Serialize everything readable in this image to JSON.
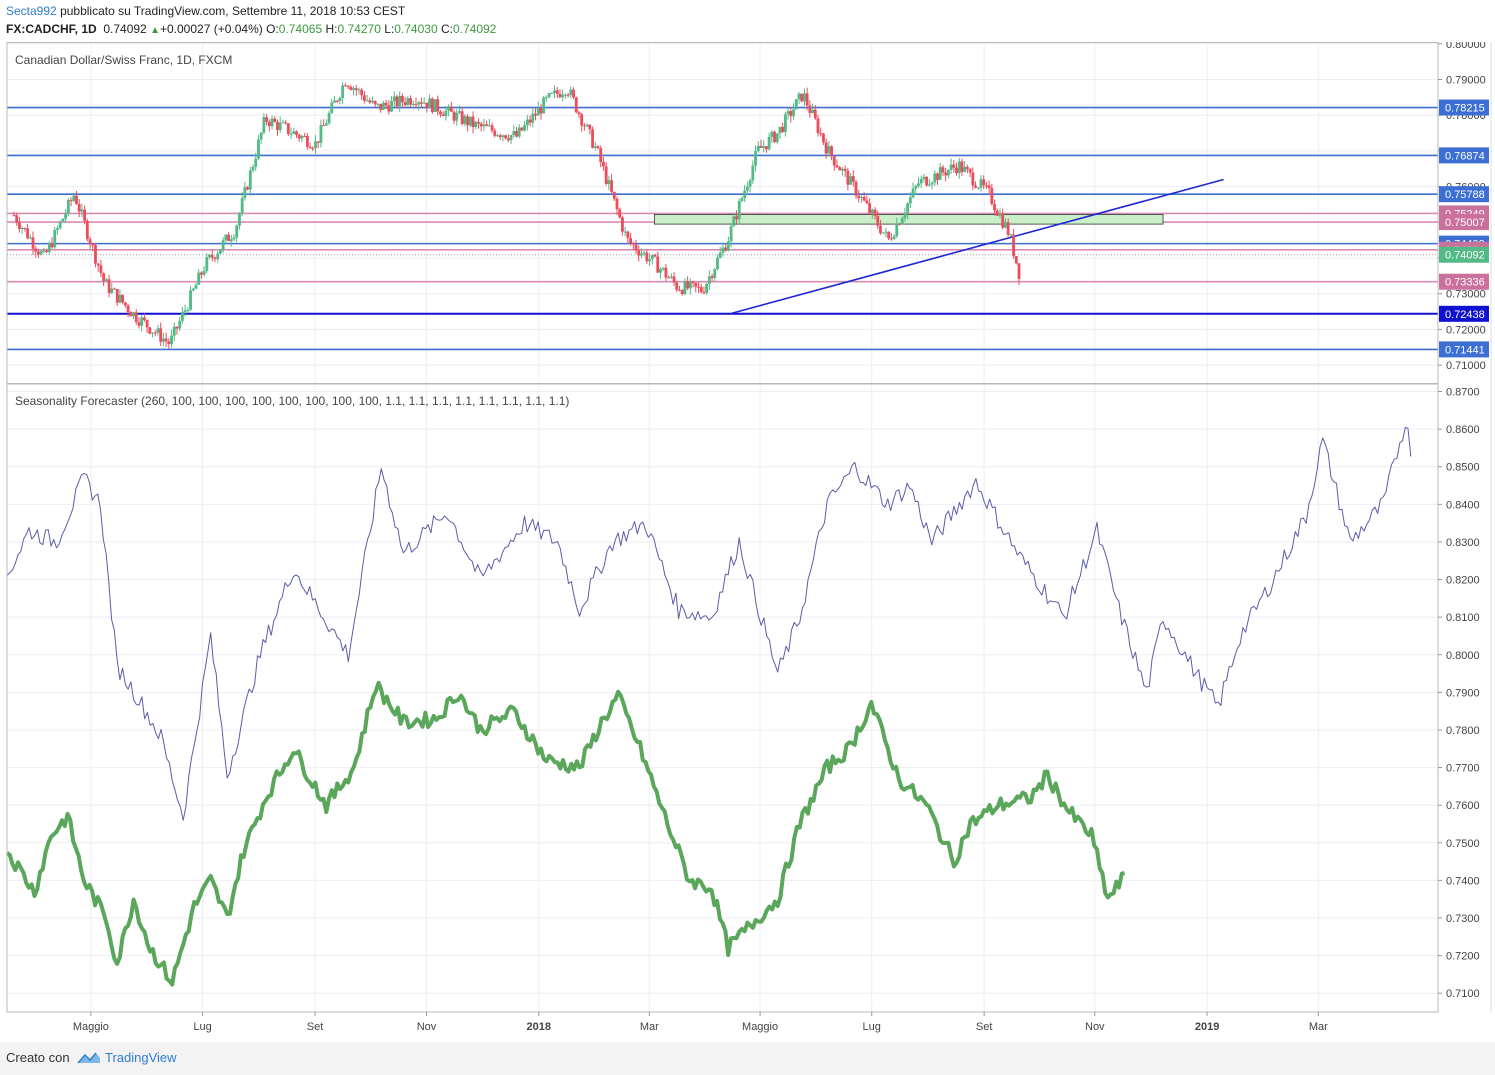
{
  "header": {
    "user": "Secta992",
    "published": "pubblicato su TradingView.com, Settembre 11, 2018 10:53 CEST",
    "symbol": "FX:CADCHF, 1D",
    "last": "0.74092",
    "change": "+0.00027 (+0.04%)",
    "o_label": "O:",
    "o_value": "0.74065",
    "h_label": "H:",
    "h_value": "0.74270",
    "l_label": "L:",
    "l_value": "0.74030",
    "c_label": "C:",
    "c_value": "0.74092"
  },
  "footer": {
    "created": "Creato con",
    "brand": "TradingView"
  },
  "colors": {
    "up": "#53b987",
    "down": "#eb4d5c",
    "hline_blue": "#3b6fd4",
    "hline_pink": "#d98cb3",
    "trend": "#1f26d6",
    "zone_fill": "#c9efc9",
    "forecast": "#5c5ca8",
    "series2": "#5aa65a"
  },
  "chart_data": [
    {
      "type": "candlestick",
      "title": "Canadian Dollar/Swiss Franc, 1D, FXCM",
      "ylim": [
        0.705,
        0.8005
      ],
      "y_ticks": [
        "0.80000",
        "0.79000",
        "0.78000",
        "0.77000",
        "0.76000",
        "0.75000",
        "0.74000",
        "0.73000",
        "0.72000",
        "0.71000"
      ],
      "horizontal_levels": [
        {
          "value": 0.78215,
          "label": "0.78215",
          "color": "blue"
        },
        {
          "value": 0.76874,
          "label": "0.76874",
          "color": "blue"
        },
        {
          "value": 0.75788,
          "label": "0.75788",
          "color": "blue"
        },
        {
          "value": 0.75249,
          "label": "0.75249",
          "color": "pink"
        },
        {
          "value": 0.75007,
          "label": "0.75007",
          "color": "pink"
        },
        {
          "value": 0.74403,
          "label": "0.74403",
          "color": "blue"
        },
        {
          "value": 0.74231,
          "label": "0.74231",
          "color": "pink"
        },
        {
          "value": 0.73336,
          "label": "0.73336",
          "color": "pink"
        },
        {
          "value": 0.72438,
          "label": "0.72438",
          "color": "navy"
        },
        {
          "value": 0.71441,
          "label": "0.71441",
          "color": "blue"
        }
      ],
      "last_price": {
        "value": 0.74092,
        "label": "0.74092"
      },
      "points": [
        [
          0.0,
          0.752
        ],
        [
          0.03,
          0.74
        ],
        [
          0.06,
          0.758
        ],
        [
          0.09,
          0.733
        ],
        [
          0.12,
          0.724
        ],
        [
          0.155,
          0.716
        ],
        [
          0.19,
          0.738
        ],
        [
          0.22,
          0.748
        ],
        [
          0.25,
          0.779
        ],
        [
          0.3,
          0.772
        ],
        [
          0.33,
          0.79
        ],
        [
          0.36,
          0.782
        ],
        [
          0.4,
          0.785
        ],
        [
          0.46,
          0.777
        ],
        [
          0.5,
          0.774
        ],
        [
          0.53,
          0.784
        ],
        [
          0.55,
          0.788
        ],
        [
          0.58,
          0.77
        ],
        [
          0.61,
          0.745
        ],
        [
          0.64,
          0.738
        ],
        [
          0.66,
          0.732
        ],
        [
          0.685,
          0.731
        ],
        [
          0.71,
          0.745
        ],
        [
          0.74,
          0.77
        ],
        [
          0.76,
          0.775
        ],
        [
          0.785,
          0.786
        ],
        [
          0.81,
          0.77
        ],
        [
          0.84,
          0.758
        ],
        [
          0.87,
          0.745
        ],
        [
          0.9,
          0.761
        ],
        [
          0.94,
          0.766
        ],
        [
          0.97,
          0.758
        ],
        [
          0.99,
          0.747
        ],
        [
          1.0,
          0.736
        ]
      ],
      "overlays": {
        "trendline": {
          "from": [
            0.658,
            0.7245
          ],
          "to": [
            1.105,
            0.762
          ]
        },
        "zone": {
          "from": 0.588,
          "to": 1.05,
          "top": 0.7522,
          "bottom": 0.7495
        }
      },
      "x_tick_labels": [
        "Maggio",
        "Lug",
        "Set",
        "Nov",
        "2018",
        "Mar",
        "Maggio",
        "Lug",
        "Set",
        "Nov",
        "2019",
        "Mar"
      ]
    },
    {
      "type": "line",
      "title": "Seasonality Forecaster (260, 100, 100, 100, 100, 100, 100, 100, 100, 1.1, 1.1, 1.1, 1.1, 1.1, 1.1, 1.1, 1.1)",
      "ylim": [
        0.705,
        0.872
      ],
      "y_ticks": [
        "0.8700",
        "0.8600",
        "0.8500",
        "0.8400",
        "0.8300",
        "0.8200",
        "0.8100",
        "0.8000",
        "0.7900",
        "0.7800",
        "0.7700",
        "0.7600",
        "0.7500",
        "0.7400",
        "0.7300",
        "0.7200",
        "0.7100"
      ],
      "series": [
        {
          "points": [
            [
              0.0,
              0.821
            ],
            [
              0.02,
              0.833
            ],
            [
              0.045,
              0.83
            ],
            [
              0.07,
              0.847
            ],
            [
              0.085,
              0.84
            ],
            [
              0.1,
              0.797
            ],
            [
              0.12,
              0.788
            ],
            [
              0.14,
              0.778
            ],
            [
              0.16,
              0.757
            ],
            [
              0.185,
              0.805
            ],
            [
              0.2,
              0.768
            ],
            [
              0.23,
              0.8
            ],
            [
              0.26,
              0.823
            ],
            [
              0.31,
              0.8
            ],
            [
              0.34,
              0.85
            ],
            [
              0.36,
              0.827
            ],
            [
              0.4,
              0.838
            ],
            [
              0.43,
              0.82
            ],
            [
              0.47,
              0.835
            ],
            [
              0.5,
              0.83
            ],
            [
              0.52,
              0.812
            ],
            [
              0.55,
              0.83
            ],
            [
              0.58,
              0.835
            ],
            [
              0.61,
              0.812
            ],
            [
              0.64,
              0.81
            ],
            [
              0.665,
              0.83
            ],
            [
              0.7,
              0.795
            ],
            [
              0.72,
              0.81
            ],
            [
              0.745,
              0.84
            ],
            [
              0.77,
              0.85
            ],
            [
              0.8,
              0.84
            ],
            [
              0.82,
              0.845
            ],
            [
              0.84,
              0.83
            ],
            [
              0.88,
              0.846
            ],
            [
              0.92,
              0.826
            ],
            [
              0.96,
              0.81
            ],
            [
              0.99,
              0.833
            ],
            [
              1.01,
              0.812
            ],
            [
              1.035,
              0.79
            ],
            [
              1.05,
              0.81
            ],
            [
              1.08,
              0.795
            ],
            [
              1.1,
              0.786
            ],
            [
              1.12,
              0.805
            ],
            [
              1.15,
              0.82
            ],
            [
              1.18,
              0.837
            ],
            [
              1.195,
              0.857
            ],
            [
              1.22,
              0.83
            ],
            [
              1.25,
              0.84
            ],
            [
              1.27,
              0.862
            ],
            [
              1.275,
              0.855
            ]
          ]
        },
        {
          "points": [
            [
              0.0,
              0.748
            ],
            [
              0.025,
              0.737
            ],
            [
              0.04,
              0.752
            ],
            [
              0.055,
              0.757
            ],
            [
              0.07,
              0.74
            ],
            [
              0.09,
              0.73
            ],
            [
              0.1,
              0.718
            ],
            [
              0.115,
              0.735
            ],
            [
              0.13,
              0.722
            ],
            [
              0.15,
              0.713
            ],
            [
              0.17,
              0.733
            ],
            [
              0.185,
              0.74
            ],
            [
              0.2,
              0.73
            ],
            [
              0.215,
              0.748
            ],
            [
              0.235,
              0.762
            ],
            [
              0.26,
              0.775
            ],
            [
              0.29,
              0.76
            ],
            [
              0.315,
              0.77
            ],
            [
              0.335,
              0.792
            ],
            [
              0.36,
              0.782
            ],
            [
              0.39,
              0.783
            ],
            [
              0.41,
              0.79
            ],
            [
              0.43,
              0.78
            ],
            [
              0.46,
              0.785
            ],
            [
              0.49,
              0.772
            ],
            [
              0.52,
              0.77
            ],
            [
              0.54,
              0.782
            ],
            [
              0.555,
              0.789
            ],
            [
              0.575,
              0.775
            ],
            [
              0.6,
              0.755
            ],
            [
              0.62,
              0.74
            ],
            [
              0.64,
              0.738
            ],
            [
              0.655,
              0.722
            ],
            [
              0.675,
              0.728
            ],
            [
              0.7,
              0.735
            ],
            [
              0.72,
              0.755
            ],
            [
              0.745,
              0.77
            ],
            [
              0.765,
              0.775
            ],
            [
              0.785,
              0.787
            ],
            [
              0.81,
              0.767
            ],
            [
              0.835,
              0.76
            ],
            [
              0.86,
              0.745
            ],
            [
              0.875,
              0.755
            ],
            [
              0.9,
              0.76
            ],
            [
              0.93,
              0.762
            ],
            [
              0.945,
              0.768
            ],
            [
              0.965,
              0.758
            ],
            [
              0.985,
              0.752
            ],
            [
              1.0,
              0.735
            ],
            [
              1.015,
              0.741
            ]
          ]
        }
      ]
    }
  ]
}
